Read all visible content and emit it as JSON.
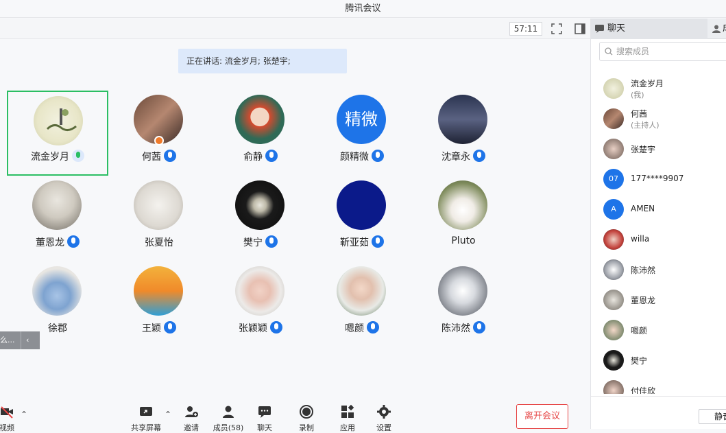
{
  "window": {
    "title": "腾讯会议"
  },
  "top": {
    "timer": "57:11",
    "speaking": "正在讲话: 流金岁月; 张楚宇;"
  },
  "participants": [
    {
      "name": "流金岁月"
    },
    {
      "name": "何茜"
    },
    {
      "name": "俞静"
    },
    {
      "name": "颜精微",
      "initials": "精微"
    },
    {
      "name": "沈章永"
    },
    {
      "name": "董恩龙"
    },
    {
      "name": "张夏怡"
    },
    {
      "name": "樊宁"
    },
    {
      "name": "靳亚茹"
    },
    {
      "name": "Pluto"
    },
    {
      "name": "徐郡"
    },
    {
      "name": "王颖"
    },
    {
      "name": "张颖颖"
    },
    {
      "name": "嗯颜"
    },
    {
      "name": "陈沛然"
    }
  ],
  "collapsed_tab": {
    "label": "么..."
  },
  "bottom": {
    "video": "视频",
    "share": "共享屏幕",
    "invite": "邀请",
    "members": "成员(58)",
    "chat": "聊天",
    "record": "录制",
    "apps": "应用",
    "settings": "设置",
    "leave": "离开会议"
  },
  "panel": {
    "tab_chat": "聊天",
    "tab_members": "成",
    "search_placeholder": "搜索成员",
    "members": [
      {
        "name": "流金岁月",
        "sub": "(我)"
      },
      {
        "name": "何茜",
        "sub": "(主持人)"
      },
      {
        "name": "张楚宇"
      },
      {
        "name": "177****9907",
        "badge": "07"
      },
      {
        "name": "AMEN",
        "badge": "A"
      },
      {
        "name": "willa"
      },
      {
        "name": "陈沛然"
      },
      {
        "name": "董恩龙"
      },
      {
        "name": "嗯颜"
      },
      {
        "name": "樊宁"
      },
      {
        "name": "付佳欣"
      }
    ],
    "mute_all": "静音"
  },
  "colors": {
    "accent": "#1e74e8",
    "active_border": "#2bbe63",
    "leave": "#e64545"
  }
}
